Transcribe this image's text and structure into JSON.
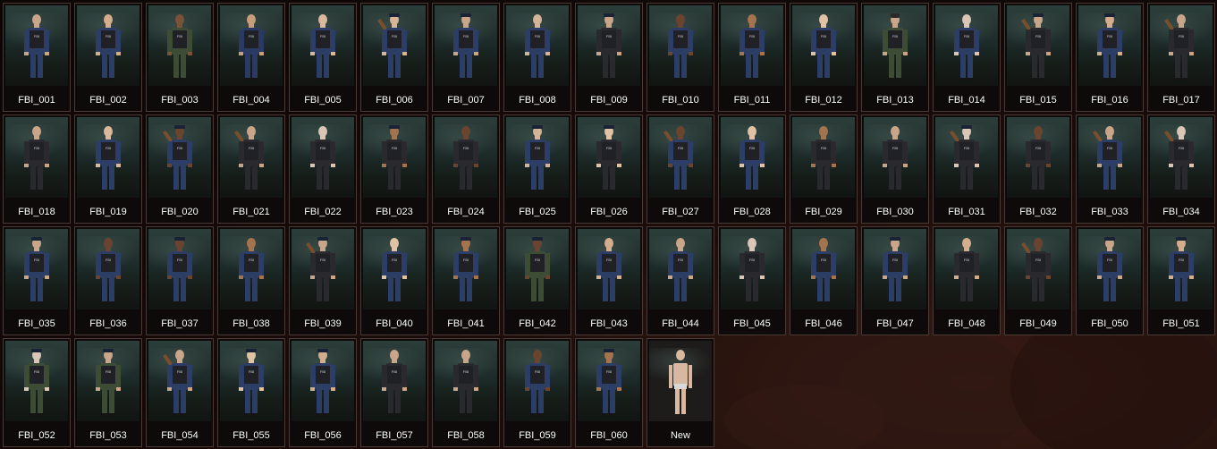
{
  "characters": [
    {
      "label": "FBI_001",
      "suit": "#2c3d66",
      "skin": "#c9a58a",
      "hat": "none",
      "gun": false
    },
    {
      "label": "FBI_002",
      "suit": "#2d3e66",
      "skin": "#d3ad8c",
      "hat": "none",
      "gun": false
    },
    {
      "label": "FBI_003",
      "suit": "#3d4c35",
      "skin": "#7a5238",
      "hat": "none",
      "gun": false
    },
    {
      "label": "FBI_004",
      "suit": "#2a3a63",
      "skin": "#c79d7c",
      "hat": "none",
      "gun": false
    },
    {
      "label": "FBI_005",
      "suit": "#2c3d66",
      "skin": "#d9b89c",
      "hat": "none",
      "gun": false
    },
    {
      "label": "FBI_006",
      "suit": "#2c3d66",
      "skin": "#d8b596",
      "hat": "cap",
      "gun": true
    },
    {
      "label": "FBI_007",
      "suit": "#2c3d66",
      "skin": "#c9a58a",
      "hat": "cap",
      "gun": false
    },
    {
      "label": "FBI_008",
      "suit": "#2c3d66",
      "skin": "#d2b49a",
      "hat": "none",
      "gun": false
    },
    {
      "label": "FBI_009",
      "suit": "#2a2a2e",
      "skin": "#c9a58a",
      "hat": "cap",
      "gun": false
    },
    {
      "label": "FBI_010",
      "suit": "#2c3d66",
      "skin": "#6b4430",
      "hat": "none",
      "gun": false
    },
    {
      "label": "FBI_011",
      "suit": "#2c3d66",
      "skin": "#a5744f",
      "hat": "none",
      "gun": false
    },
    {
      "label": "FBI_012",
      "suit": "#2c3d66",
      "skin": "#e0c2a5",
      "hat": "none",
      "gun": false
    },
    {
      "label": "FBI_013",
      "suit": "#3d4c35",
      "skin": "#c9a58a",
      "hat": "beanie",
      "gun": false
    },
    {
      "label": "FBI_014",
      "suit": "#2c3d66",
      "skin": "#d9c6b6",
      "hat": "none",
      "gun": false
    },
    {
      "label": "FBI_015",
      "suit": "#2a2a2e",
      "skin": "#c9a58a",
      "hat": "cap",
      "gun": true
    },
    {
      "label": "FBI_016",
      "suit": "#2c3d66",
      "skin": "#d3ad8c",
      "hat": "cap",
      "gun": false
    },
    {
      "label": "FBI_017",
      "suit": "#2a2a2e",
      "skin": "#c9a58a",
      "hat": "none",
      "gun": true
    },
    {
      "label": "FBI_018",
      "suit": "#2a2a2e",
      "skin": "#c9a58a",
      "hat": "none",
      "gun": false
    },
    {
      "label": "FBI_019",
      "suit": "#2c3d66",
      "skin": "#d9b89c",
      "hat": "none",
      "gun": false
    },
    {
      "label": "FBI_020",
      "suit": "#2c3d66",
      "skin": "#6b4430",
      "hat": "cap",
      "gun": true
    },
    {
      "label": "FBI_021",
      "suit": "#2a2a2e",
      "skin": "#c9a58a",
      "hat": "none",
      "gun": true
    },
    {
      "label": "FBI_022",
      "suit": "#2a2a2e",
      "skin": "#d9c6b6",
      "hat": "none",
      "gun": false
    },
    {
      "label": "FBI_023",
      "suit": "#2a2a2e",
      "skin": "#a5744f",
      "hat": "cap",
      "gun": false
    },
    {
      "label": "FBI_024",
      "suit": "#2a2a2e",
      "skin": "#6b4430",
      "hat": "none",
      "gun": false
    },
    {
      "label": "FBI_025",
      "suit": "#2c3d66",
      "skin": "#d2b49a",
      "hat": "cap",
      "gun": false
    },
    {
      "label": "FBI_026",
      "suit": "#2a2a2e",
      "skin": "#e0c2a5",
      "hat": "cap",
      "gun": false
    },
    {
      "label": "FBI_027",
      "suit": "#2c3d66",
      "skin": "#6b4430",
      "hat": "none",
      "gun": true
    },
    {
      "label": "FBI_028",
      "suit": "#2c3d66",
      "skin": "#e0c2a5",
      "hat": "none",
      "gun": false
    },
    {
      "label": "FBI_029",
      "suit": "#2a2a2e",
      "skin": "#a5744f",
      "hat": "none",
      "gun": false
    },
    {
      "label": "FBI_030",
      "suit": "#2a2a2e",
      "skin": "#c9a58a",
      "hat": "none",
      "gun": false
    },
    {
      "label": "FBI_031",
      "suit": "#2a2a2e",
      "skin": "#d9c6b6",
      "hat": "cap",
      "gun": true
    },
    {
      "label": "FBI_032",
      "suit": "#2a2a2e",
      "skin": "#6b4430",
      "hat": "none",
      "gun": false
    },
    {
      "label": "FBI_033",
      "suit": "#2c3d66",
      "skin": "#c9a58a",
      "hat": "none",
      "gun": true
    },
    {
      "label": "FBI_034",
      "suit": "#2a2a2e",
      "skin": "#d9c6b6",
      "hat": "none",
      "gun": true
    },
    {
      "label": "FBI_035",
      "suit": "#2c3d66",
      "skin": "#c9a58a",
      "hat": "cap",
      "gun": false
    },
    {
      "label": "FBI_036",
      "suit": "#2c3d66",
      "skin": "#6b4430",
      "hat": "none",
      "gun": false
    },
    {
      "label": "FBI_037",
      "suit": "#2c3d66",
      "skin": "#6b4430",
      "hat": "cap",
      "gun": false
    },
    {
      "label": "FBI_038",
      "suit": "#2c3d66",
      "skin": "#a5744f",
      "hat": "none",
      "gun": false
    },
    {
      "label": "FBI_039",
      "suit": "#2a2a2e",
      "skin": "#c9a58a",
      "hat": "cap",
      "gun": true
    },
    {
      "label": "FBI_040",
      "suit": "#2c3d66",
      "skin": "#e0c2a5",
      "hat": "none",
      "gun": false
    },
    {
      "label": "FBI_041",
      "suit": "#2c3d66",
      "skin": "#a5744f",
      "hat": "cap",
      "gun": false
    },
    {
      "label": "FBI_042",
      "suit": "#3d4c35",
      "skin": "#6b4430",
      "hat": "cap",
      "gun": false
    },
    {
      "label": "FBI_043",
      "suit": "#2c3d66",
      "skin": "#d3ad8c",
      "hat": "none",
      "gun": false
    },
    {
      "label": "FBI_044",
      "suit": "#2c3d66",
      "skin": "#c9a58a",
      "hat": "none",
      "gun": false
    },
    {
      "label": "FBI_045",
      "suit": "#2a2a2e",
      "skin": "#d9c6b6",
      "hat": "none",
      "gun": false
    },
    {
      "label": "FBI_046",
      "suit": "#2c3d66",
      "skin": "#a5744f",
      "hat": "none",
      "gun": false
    },
    {
      "label": "FBI_047",
      "suit": "#2c3d66",
      "skin": "#c9a58a",
      "hat": "cap",
      "gun": false
    },
    {
      "label": "FBI_048",
      "suit": "#2a2a2e",
      "skin": "#d3ad8c",
      "hat": "none",
      "gun": false
    },
    {
      "label": "FBI_049",
      "suit": "#2a2a2e",
      "skin": "#6b4430",
      "hat": "none",
      "gun": true
    },
    {
      "label": "FBI_050",
      "suit": "#2c3d66",
      "skin": "#c9a58a",
      "hat": "cap",
      "gun": false
    },
    {
      "label": "FBI_051",
      "suit": "#2c3d66",
      "skin": "#d3ad8c",
      "hat": "cap",
      "gun": false
    },
    {
      "label": "FBI_052",
      "suit": "#3d4c35",
      "skin": "#d9c6b6",
      "hat": "cap",
      "gun": false
    },
    {
      "label": "FBI_053",
      "suit": "#3d4c35",
      "skin": "#c9a58a",
      "hat": "cap",
      "gun": false
    },
    {
      "label": "FBI_054",
      "suit": "#2c3d66",
      "skin": "#c9a58a",
      "hat": "none",
      "gun": true
    },
    {
      "label": "FBI_055",
      "suit": "#2c3d66",
      "skin": "#e0c2a5",
      "hat": "cap",
      "gun": false
    },
    {
      "label": "FBI_056",
      "suit": "#2c3d66",
      "skin": "#d3ad8c",
      "hat": "cap",
      "gun": false
    },
    {
      "label": "FBI_057",
      "suit": "#2a2a2e",
      "skin": "#c9a58a",
      "hat": "none",
      "gun": false
    },
    {
      "label": "FBI_058",
      "suit": "#2a2a2e",
      "skin": "#c9a58a",
      "hat": "none",
      "gun": false
    },
    {
      "label": "FBI_059",
      "suit": "#2c3d66",
      "skin": "#6b4430",
      "hat": "none",
      "gun": false
    },
    {
      "label": "FBI_060",
      "suit": "#2c3d66",
      "skin": "#a5744f",
      "hat": "cap",
      "gun": false
    }
  ],
  "new_item": {
    "label": "New",
    "skin": "#d8b8a0",
    "briefs": "#d8d8d8"
  },
  "colors": {
    "tile_border": "#4a3a36",
    "label": "#ffffff",
    "vest": "#1f2126"
  }
}
